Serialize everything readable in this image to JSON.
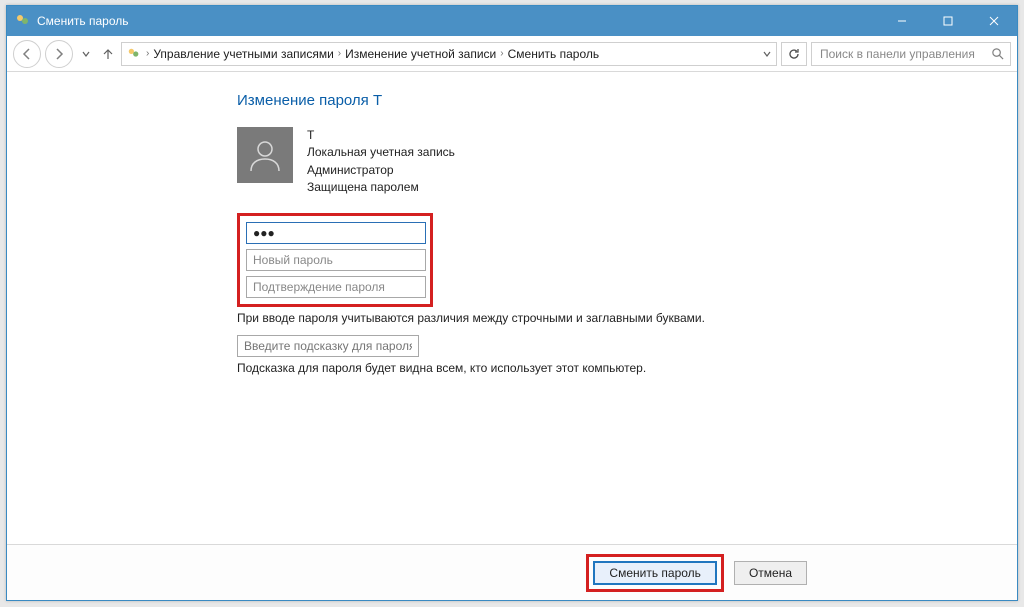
{
  "window": {
    "title": "Сменить пароль"
  },
  "breadcrumb": {
    "items": [
      "Управление учетными записями",
      "Изменение учетной записи",
      "Сменить пароль"
    ]
  },
  "search": {
    "placeholder": "Поиск в панели управления"
  },
  "page": {
    "heading": "Изменение пароля T",
    "user": {
      "name": "T",
      "account_type": "Локальная учетная запись",
      "role": "Администратор",
      "protection": "Защищена паролем"
    },
    "fields": {
      "current_password_value": "●●●",
      "new_password_placeholder": "Новый пароль",
      "confirm_password_placeholder": "Подтверждение пароля",
      "hint_placeholder": "Введите подсказку для пароля"
    },
    "case_note": "При вводе пароля учитываются различия между строчными и заглавными буквами.",
    "hint_note": "Подсказка для пароля будет видна всем, кто использует этот компьютер."
  },
  "actions": {
    "submit": "Сменить пароль",
    "cancel": "Отмена"
  }
}
